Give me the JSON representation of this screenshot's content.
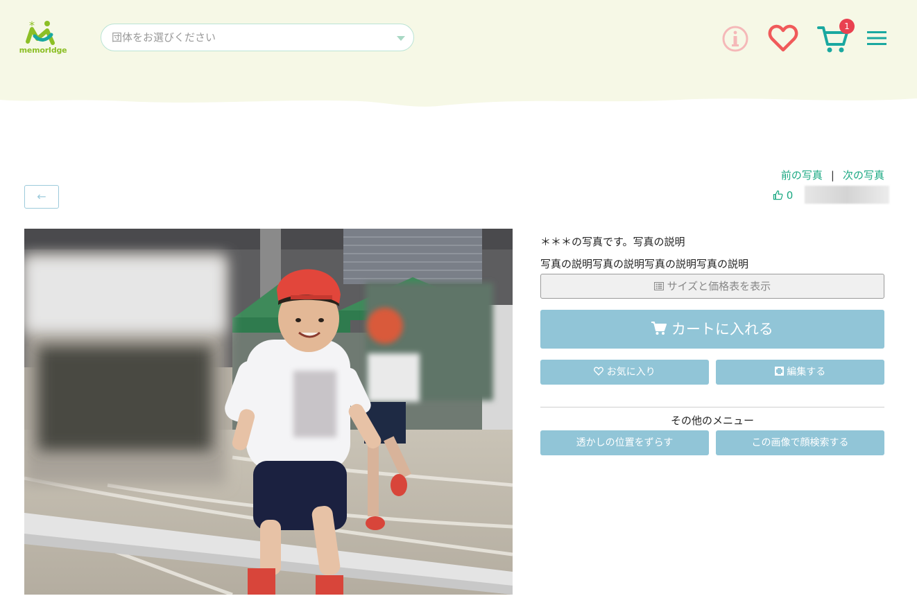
{
  "header": {
    "logo_text": "memorIdge",
    "org_select_placeholder": "団体をお選びください",
    "cart_count": "1"
  },
  "nav": {
    "prev_label": "前の写真",
    "separator": "|",
    "next_label": "次の写真",
    "like_count": "0",
    "back_icon": "←"
  },
  "photo": {
    "desc_line1": "＊＊＊の写真です。写真の説明",
    "desc_line2": "写真の説明写真の説明写真の説明写真の説明"
  },
  "actions": {
    "size_table_label": "サイズと価格表を表示",
    "add_to_cart_label": "カートに入れる",
    "favorite_label": "お気に入り",
    "edit_label": "編集する",
    "other_menu_title": "その他のメニュー",
    "watermark_label": "透かしの位置をずらす",
    "face_search_label": "この画像で顔検索する"
  },
  "colors": {
    "header_bg": "#f6f8e6",
    "accent_green": "#1aa882",
    "button_blue": "#91c5d7",
    "heart_red": "#f05a5a",
    "cart_teal": "#1aa8a0",
    "badge_red": "#e94150"
  },
  "icons": [
    "info-icon",
    "heart-icon",
    "cart-icon",
    "menu-icon",
    "arrow-left-icon",
    "thumbs-up-icon",
    "list-icon",
    "cart-small-icon",
    "heart-outline-icon",
    "edit-icon"
  ]
}
